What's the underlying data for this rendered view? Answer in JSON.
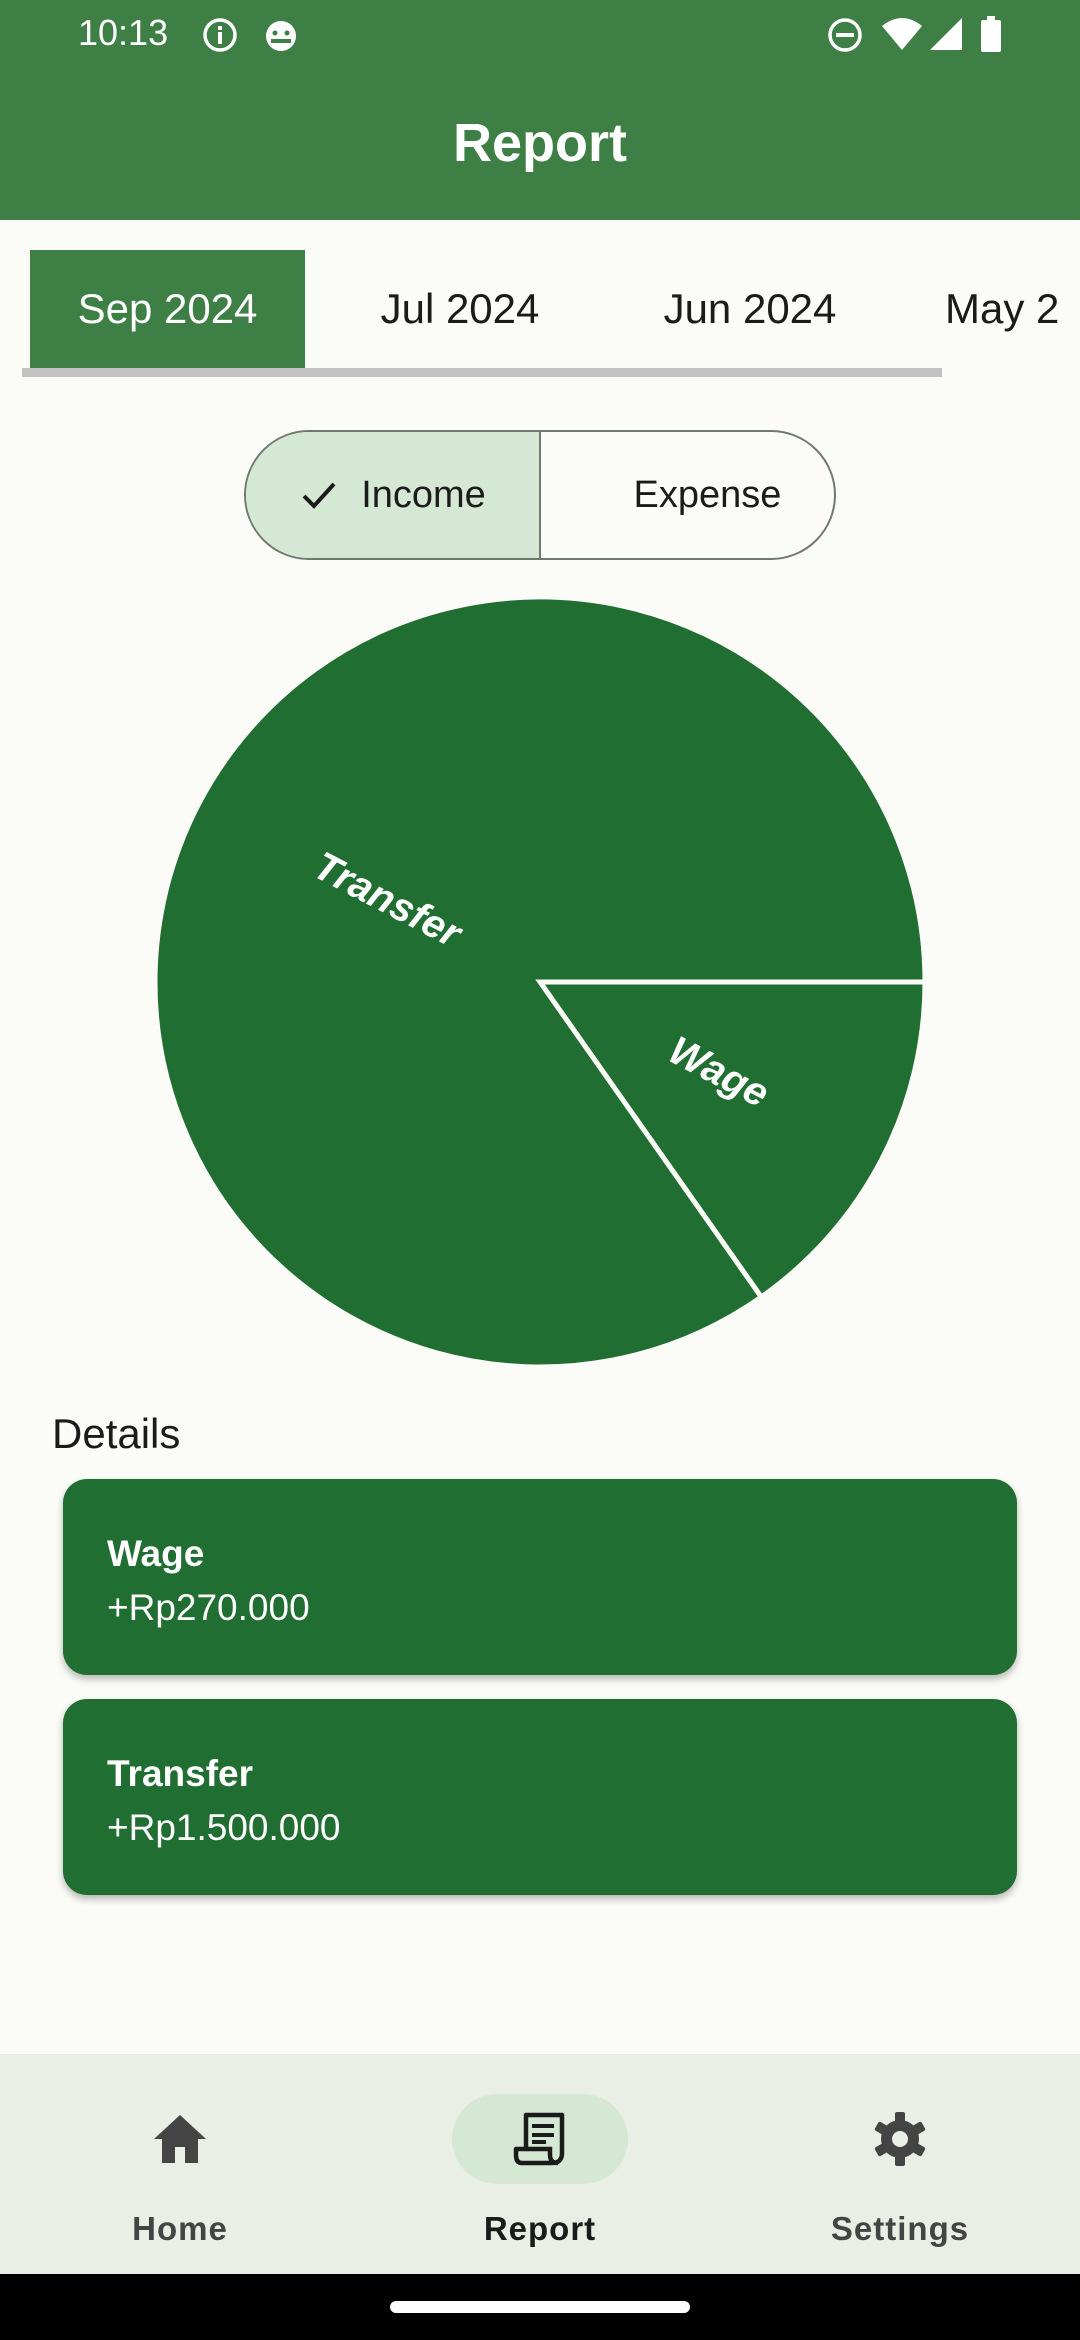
{
  "status_bar": {
    "time": "10:13"
  },
  "app_bar": {
    "title": "Report"
  },
  "month_tabs": [
    {
      "label": "Sep 2024",
      "selected": true
    },
    {
      "label": "Jul 2024",
      "selected": false
    },
    {
      "label": "Jun 2024",
      "selected": false
    },
    {
      "label": "May 2",
      "selected": false
    }
  ],
  "type_toggle": {
    "income": "Income",
    "expense": "Expense",
    "selected": "Income"
  },
  "chart_data": {
    "type": "pie",
    "slices": [
      {
        "label": "Transfer",
        "value": 1500000
      },
      {
        "label": "Wage",
        "value": 270000
      }
    ]
  },
  "details": {
    "label": "Details",
    "items": [
      {
        "name": "Wage",
        "amount": "+Rp270.000"
      },
      {
        "name": "Transfer",
        "amount": "+Rp1.500.000"
      }
    ]
  },
  "bottom_nav": {
    "items": [
      {
        "label": "Home",
        "icon": "home-icon",
        "active": false
      },
      {
        "label": "Report",
        "icon": "receipt-icon",
        "active": true
      },
      {
        "label": "Settings",
        "icon": "gear-icon",
        "active": false
      }
    ]
  },
  "colors": {
    "primary": "#3e7f45",
    "chart": "#216e32",
    "selected_bg": "#d5e8d3"
  }
}
